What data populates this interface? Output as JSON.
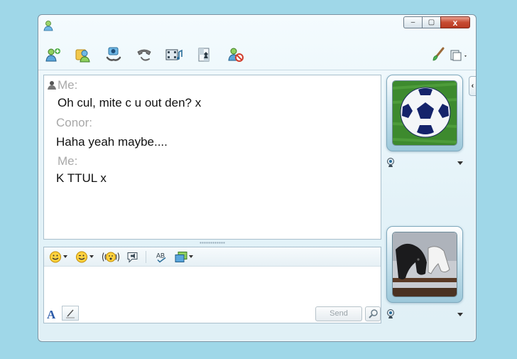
{
  "window": {
    "controls": {
      "minimize": "–",
      "maximize": "▢",
      "close": "x"
    }
  },
  "toolbar": {
    "icons": [
      "invite-contact-icon",
      "share-icon",
      "video-call-icon",
      "voice-call-icon",
      "media-icon",
      "games-icon",
      "block-icon",
      "paint-brush-icon",
      "menu-icon"
    ]
  },
  "conversation": {
    "messages": [
      {
        "sender": "Me:",
        "text": "Oh cul, mite c u out den? x"
      },
      {
        "sender": "Conor:",
        "text": "Haha yeah maybe...."
      },
      {
        "sender": "Me:",
        "text": "K TTUL x"
      }
    ]
  },
  "compose": {
    "toolbar_icons": [
      "emoticon-icon",
      "wink-icon",
      "nudge-icon",
      "voice-clip-icon",
      "spell-check-icon",
      "background-icon"
    ],
    "input_value": "",
    "send_label": "Send"
  },
  "sidebar": {
    "collapse_label": "‹"
  },
  "colors": {
    "background": "#9fd7e8",
    "sender_name": "#a8a8a8",
    "message_text": "#111111"
  }
}
